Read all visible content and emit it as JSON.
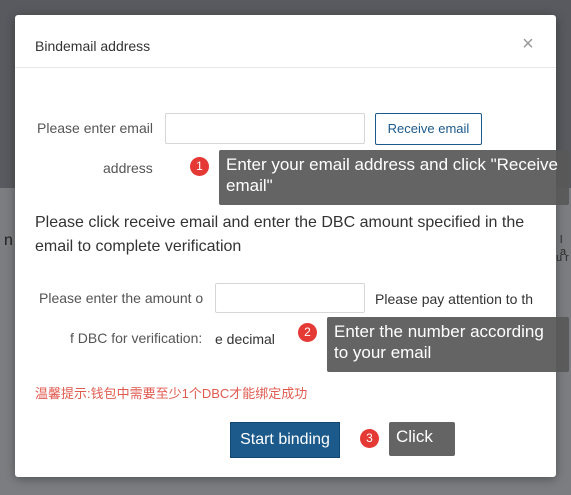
{
  "background": {
    "left_fragment": "n",
    "right_fragment_1": "l a",
    "right_fragment_2": "u r"
  },
  "dialog": {
    "title": "Bindemail address",
    "close_glyph": "×",
    "email_label_line1": "Please enter email",
    "email_label_line2": "address",
    "email_input_value": "",
    "receive_button": "Receive email",
    "instruction": "Please click receive email and enter the DBC amount specified in the email to complete verification",
    "amount_label_line1": "Please enter the amount o",
    "amount_label_line2": "f DBC for verification:",
    "amount_input_value": "",
    "note_line1": "Please pay attention to th",
    "note_line2": "e decimal",
    "warning": "温馨提示:钱包中需要至少1个DBC才能绑定成功",
    "submit_button": "Start binding"
  },
  "tutorial": {
    "steps": [
      {
        "number": "1",
        "text": "Enter your email address and click \"Receive email\""
      },
      {
        "number": "2",
        "text": "Enter the number according to your email"
      },
      {
        "number": "3",
        "text": "Click"
      }
    ]
  },
  "colors": {
    "primary": "#1d5a8c",
    "warning": "#e05a4f",
    "badge": "#e53935",
    "tooltip": "#585858"
  }
}
